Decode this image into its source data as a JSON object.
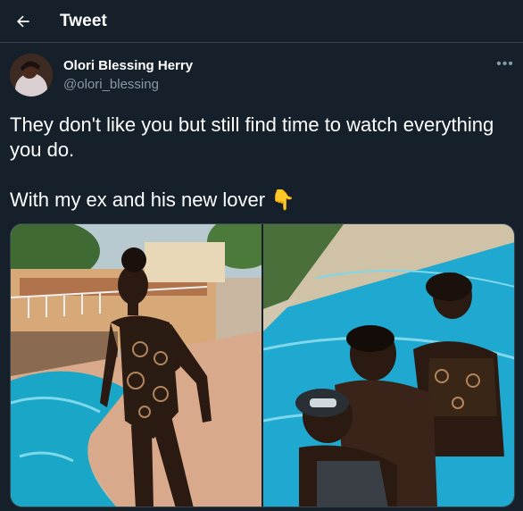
{
  "header": {
    "title": "Tweet",
    "back_icon": "arrow-left-icon"
  },
  "tweet": {
    "author_name": "Olori Blessing Herry",
    "author_handle": "@olori_blessing",
    "more_icon": "more-horizontal-icon",
    "text_line1": "They don't like you but still find time to watch everything you do.",
    "text_line2": "With my ex and his new lover 👇",
    "media_count": 2
  },
  "colors": {
    "background": "#15202b",
    "border": "#38444d",
    "secondary_text": "#8899a6",
    "primary_text": "#ffffff"
  }
}
